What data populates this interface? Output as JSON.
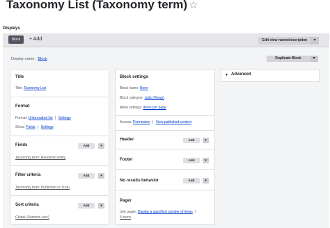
{
  "page": {
    "title": "Taxonomy List (Taxonomy term)",
    "star_glyph": "☆",
    "displays_label": "Displays"
  },
  "tabs": {
    "active": "Block",
    "add": "+ Add"
  },
  "toolbar": {
    "edit_view": "Edit view name/description",
    "duplicate": "Duplicate Block",
    "dropdown_glyph": "▾"
  },
  "display_name": {
    "label": "Display name:",
    "value": "Block"
  },
  "col1": {
    "title_heading": "Title",
    "title_label": "Title:",
    "title_value": "Taxonomy List",
    "format_heading": "Format",
    "format_label": "Format:",
    "format_value": "Unformatted list",
    "format_sep": "|",
    "format_settings": "Settings",
    "show_label": "Show:",
    "show_value": "Fields",
    "show_sep": "|",
    "show_settings": "Settings",
    "fields_heading": "Fields",
    "fields_item": "Taxonomy term: Rendered entity",
    "filter_heading": "Filter criteria",
    "filter_item": "Taxonomy term: Published (= True)",
    "sort_heading": "Sort criteria",
    "sort_item": "Global: Random (asc)",
    "add_label": "Add"
  },
  "col2": {
    "block_settings_heading": "Block settings",
    "block_name_label": "Block name:",
    "block_name_value": "None",
    "block_category_label": "Block category:",
    "block_category_value": "Lists (Views)",
    "allow_label": "Allow settings:",
    "allow_value": "Items per page",
    "access_label": "Access:",
    "access_value": "Permission",
    "access_sep": "|",
    "access_value2": "View published content",
    "header_heading": "Header",
    "footer_heading": "Footer",
    "no_results_heading": "No results behavior",
    "pager_heading": "Pager",
    "pager_use_label": "Use pager:",
    "pager_use_value": "Display a specified number of items",
    "pager_sep": "|",
    "pager_items": "5 items",
    "add_label": "Add"
  },
  "col3": {
    "advanced": "Advanced",
    "advanced_glyph": "▼"
  }
}
